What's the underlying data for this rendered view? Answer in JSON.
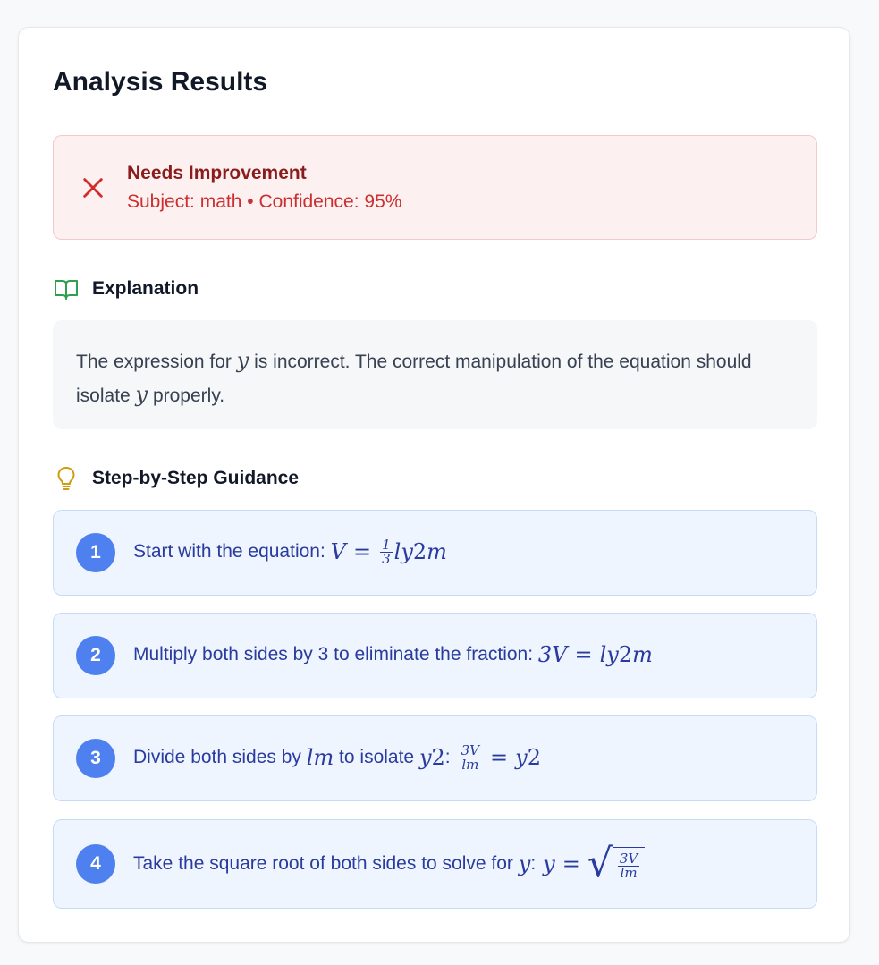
{
  "page": {
    "title": "Analysis Results"
  },
  "status": {
    "icon": "close-x-icon",
    "title": "Needs Improvement",
    "subject_label": "Subject:",
    "subject": "math",
    "separator": "•",
    "confidence_label": "Confidence:",
    "confidence": "95%",
    "colors": {
      "background": "#fdf0f0",
      "title": "#8b1c1c",
      "meta": "#cc2f2f"
    }
  },
  "explanation": {
    "heading": "Explanation",
    "icon": "book-open-icon",
    "text_part1": "The expression for ",
    "var1": "y",
    "text_part2": " is incorrect. The correct manipulation of the equation should isolate ",
    "var2": "y",
    "text_part3": " properly."
  },
  "guidance": {
    "heading": "Step-by-Step Guidance",
    "icon": "lightbulb-icon",
    "accent_color": "#4f80f0",
    "steps": [
      {
        "number": "1",
        "text": "Start with the equation: ",
        "math": {
          "lhs": "V",
          "eq": "=",
          "frac_num": "1",
          "frac_den": "3",
          "rest": "ly",
          "exp": "2",
          "tail": "m"
        }
      },
      {
        "number": "2",
        "text": "Multiply both sides by 3 to eliminate the fraction: ",
        "math": {
          "lhs": "3V",
          "eq": "=",
          "rest": "ly",
          "exp": "2",
          "tail": "m"
        }
      },
      {
        "number": "3",
        "text_a": "Divide both sides by ",
        "var_a": "lm",
        "text_b": " to isolate ",
        "var_b": "y",
        "exp_b": "2",
        "colon": ":",
        "math": {
          "frac_num": "3V",
          "frac_den": "lm",
          "eq": "=",
          "rhs": "y",
          "exp": "2"
        }
      },
      {
        "number": "4",
        "text_a": "Take the square root of both sides to solve for ",
        "var_a": "y",
        "colon": ":",
        "math": {
          "lhs": "y",
          "eq": "=",
          "radical": "√",
          "frac_num": "3V",
          "frac_den": "lm"
        }
      }
    ]
  }
}
